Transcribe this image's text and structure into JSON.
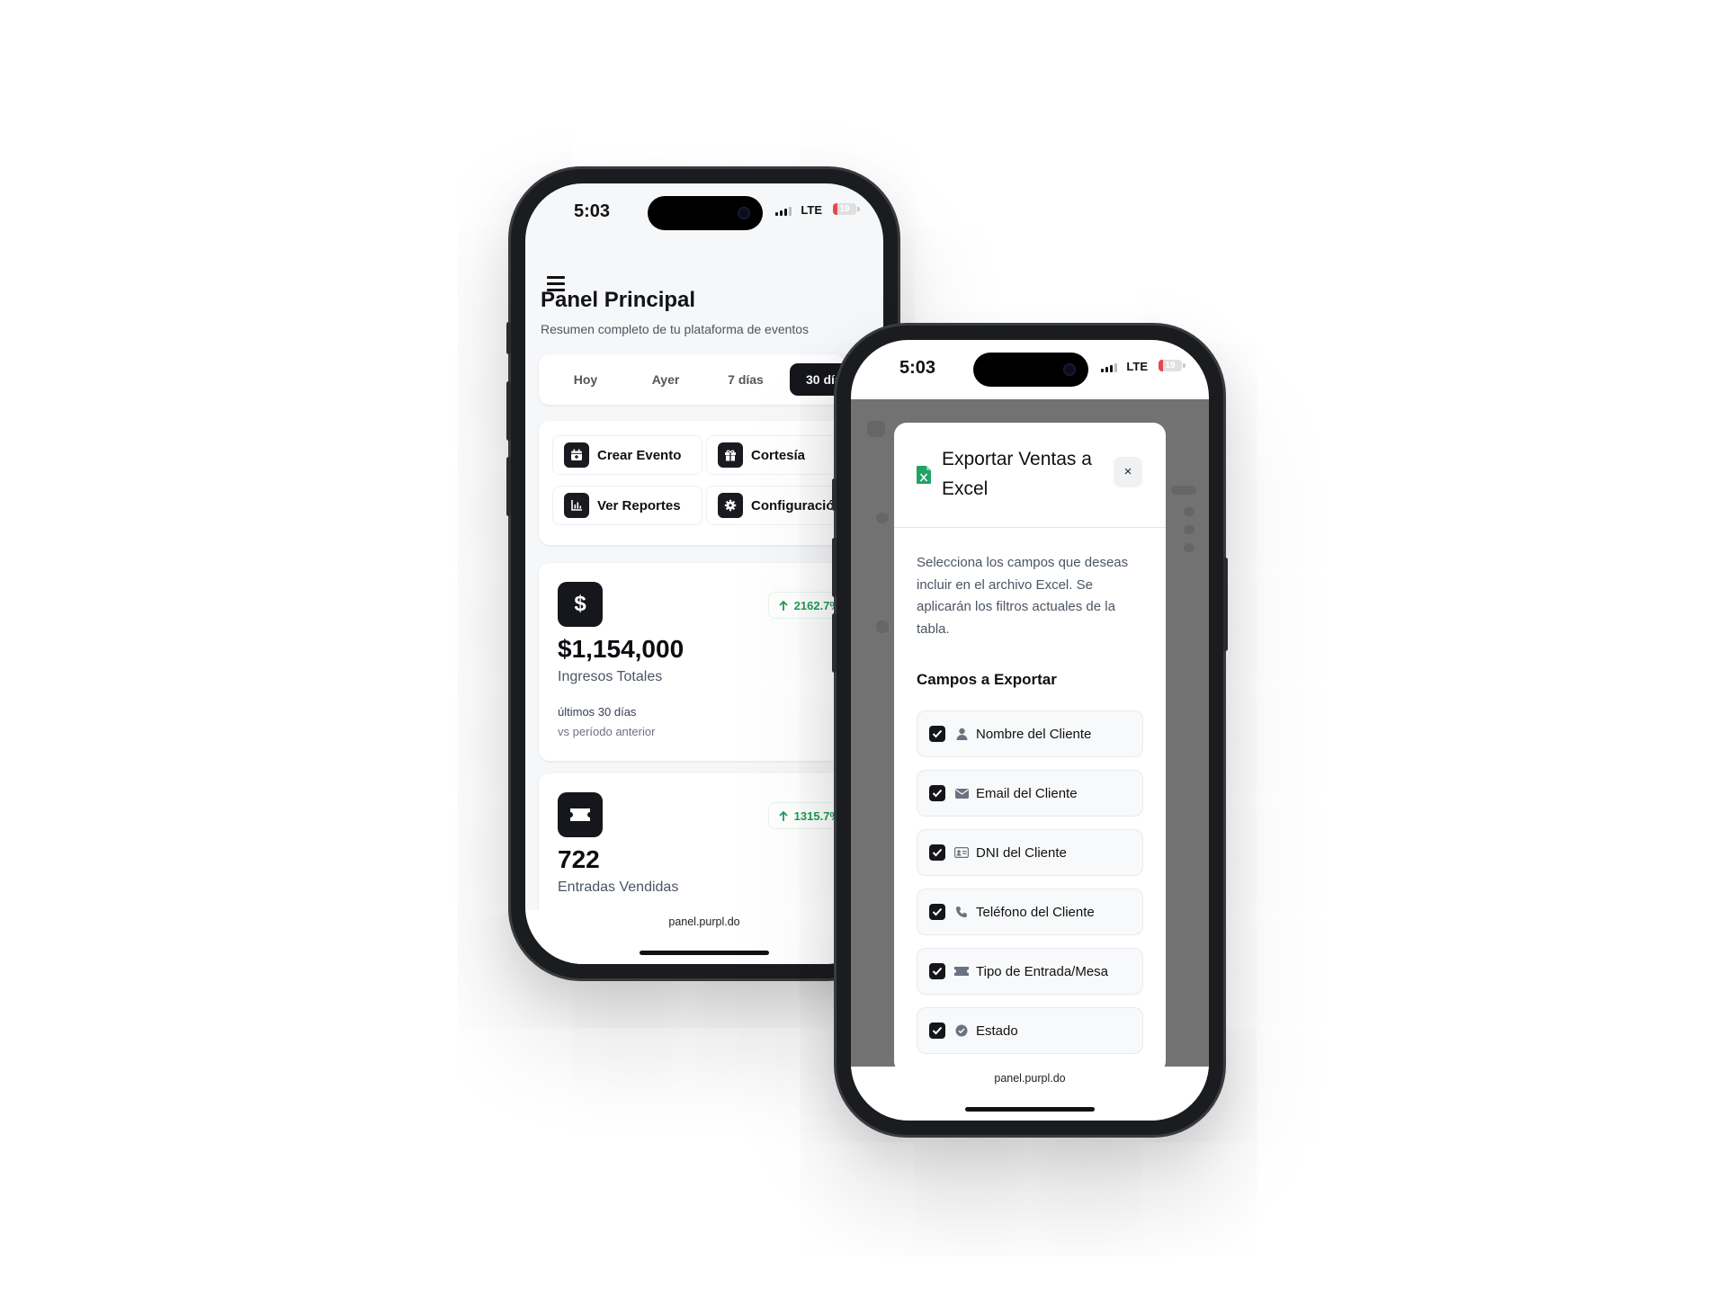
{
  "phone_main": {
    "status": {
      "time": "5:03",
      "network": "LTE",
      "battery": "19"
    },
    "header": {
      "title": "Panel Principal",
      "subtitle": "Resumen completo de tu plataforma de eventos"
    },
    "range_tabs": [
      {
        "label": "Hoy"
      },
      {
        "label": "Ayer"
      },
      {
        "label": "7 días"
      },
      {
        "label": "30 días",
        "active": true
      }
    ],
    "quick_actions": [
      {
        "label": "Crear Evento",
        "icon": "calendar-plus-icon"
      },
      {
        "label": "Cortesía",
        "icon": "gift-icon"
      },
      {
        "label": "Ver Reportes",
        "icon": "chart-icon"
      },
      {
        "label": "Configuración",
        "icon": "gear-icon"
      }
    ],
    "stats": [
      {
        "icon": "dollar-icon",
        "value": "$1,154,000",
        "label": "Ingresos Totales",
        "trend": "2162.7%",
        "period": "últimos 30 días",
        "compare": "vs período anterior"
      },
      {
        "icon": "ticket-icon",
        "value": "722",
        "label": "Entradas Vendidas",
        "trend": "1315.7%"
      }
    ],
    "url": "panel.purpl.do"
  },
  "phone_modal": {
    "status": {
      "time": "5:03",
      "network": "LTE",
      "battery": "19"
    },
    "modal": {
      "title": "Exportar Ventas a Excel",
      "close_label": "×",
      "description": "Selecciona los campos que deseas incluir en el archivo Excel. Se aplicarán los filtros actuales de la tabla.",
      "section_title": "Campos a Exportar",
      "fields": [
        {
          "label": "Nombre del Cliente",
          "icon": "user-icon",
          "checked": true
        },
        {
          "label": "Email del Cliente",
          "icon": "envelope-icon",
          "checked": true
        },
        {
          "label": "DNI del Cliente",
          "icon": "id-card-icon",
          "checked": true
        },
        {
          "label": "Teléfono del Cliente",
          "icon": "phone-icon",
          "checked": true
        },
        {
          "label": "Tipo de Entrada/Mesa",
          "icon": "ticket-icon",
          "checked": true
        },
        {
          "label": "Estado",
          "icon": "check-circle-icon",
          "checked": true
        }
      ]
    },
    "url": "panel.purpl.do"
  },
  "colors": {
    "accent_dark": "#16171d",
    "trend_green": "#1f9d55",
    "excel_green": "#21a366",
    "battery_red": "#e5484d"
  }
}
